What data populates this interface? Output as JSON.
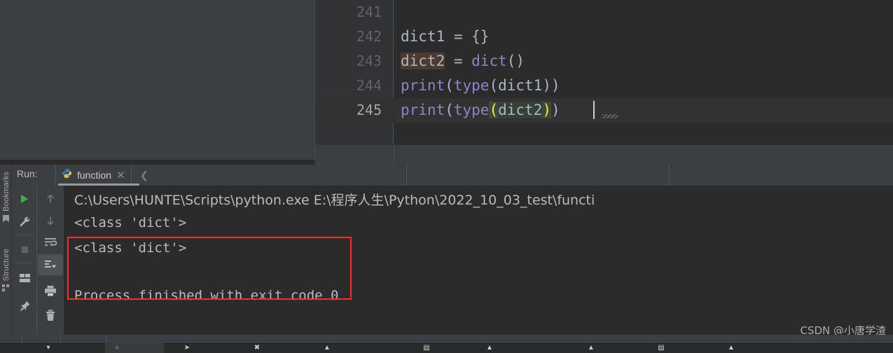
{
  "editor": {
    "lines": [
      {
        "number": "241",
        "text": "",
        "current": false
      },
      {
        "number": "242",
        "text": "dict1 = {}",
        "current": false
      },
      {
        "number": "243",
        "text": "dict2 = dict()",
        "current": false
      },
      {
        "number": "244",
        "text": "print(type(dict1))",
        "current": false
      },
      {
        "number": "245",
        "text": "print(type(dict2))",
        "current": true
      }
    ],
    "line241_number": "241",
    "line242_number": "242",
    "line243_number": "243",
    "line244_number": "244",
    "line245_number": "245",
    "l242": {
      "a": "dict1",
      "b": " = ",
      "c": "{}"
    },
    "l243": {
      "a": "dict2",
      "b": " = ",
      "c": "dict",
      "d": "()"
    },
    "l244": {
      "a": "print",
      "b": "(",
      "c": "type",
      "d": "(",
      "e": "dict1",
      "f": "))"
    },
    "l245": {
      "a": "print",
      "b": "(",
      "c": "type",
      "d": "(",
      "e": "dict2",
      "f": ")",
      "g": ")"
    }
  },
  "sidebar": {
    "bookmarks_label": "Bookmarks",
    "structure_label": "Structure",
    "bookmarks_icon": "bookmark-icon",
    "structure_icon": "structure-icon"
  },
  "run_window": {
    "label": "Run:",
    "tab_name": "function",
    "tab_icon": "python-icon",
    "close_icon": "close-icon",
    "chevron_icon": "chevron-left-icon",
    "toolbar_primary": [
      {
        "name": "rerun-button",
        "icon": "play-icon"
      },
      {
        "name": "edit-configurations-button",
        "icon": "wrench-icon"
      },
      {
        "name": "stop-button",
        "icon": "stop-icon"
      },
      {
        "name": "layout-button",
        "icon": "layout-icon"
      },
      {
        "name": "pin-tab-button",
        "icon": "pin-icon"
      }
    ],
    "toolbar_secondary": [
      {
        "name": "prev-occurrence-button",
        "icon": "arrow-up-icon"
      },
      {
        "name": "next-occurrence-button",
        "icon": "arrow-down-icon"
      },
      {
        "name": "soft-wrap-button",
        "icon": "soft-wrap-icon"
      },
      {
        "name": "scroll-to-end-button",
        "icon": "scroll-to-end-icon"
      },
      {
        "name": "print-button",
        "icon": "printer-icon"
      },
      {
        "name": "clear-all-button",
        "icon": "trash-icon"
      }
    ]
  },
  "console": {
    "command_line": "C:\\Users\\HUNTE\\Scripts\\python.exe E:\\程序人生\\Python\\2022_10_03_test\\functi",
    "output_line_1": "<class 'dict'>",
    "output_line_2": "<class 'dict'>",
    "exit_line": "Process finished with exit code 0"
  },
  "annotation": {
    "color": "#ff2a2a"
  },
  "watermark": {
    "text": "CSDN @小唐学渣"
  }
}
